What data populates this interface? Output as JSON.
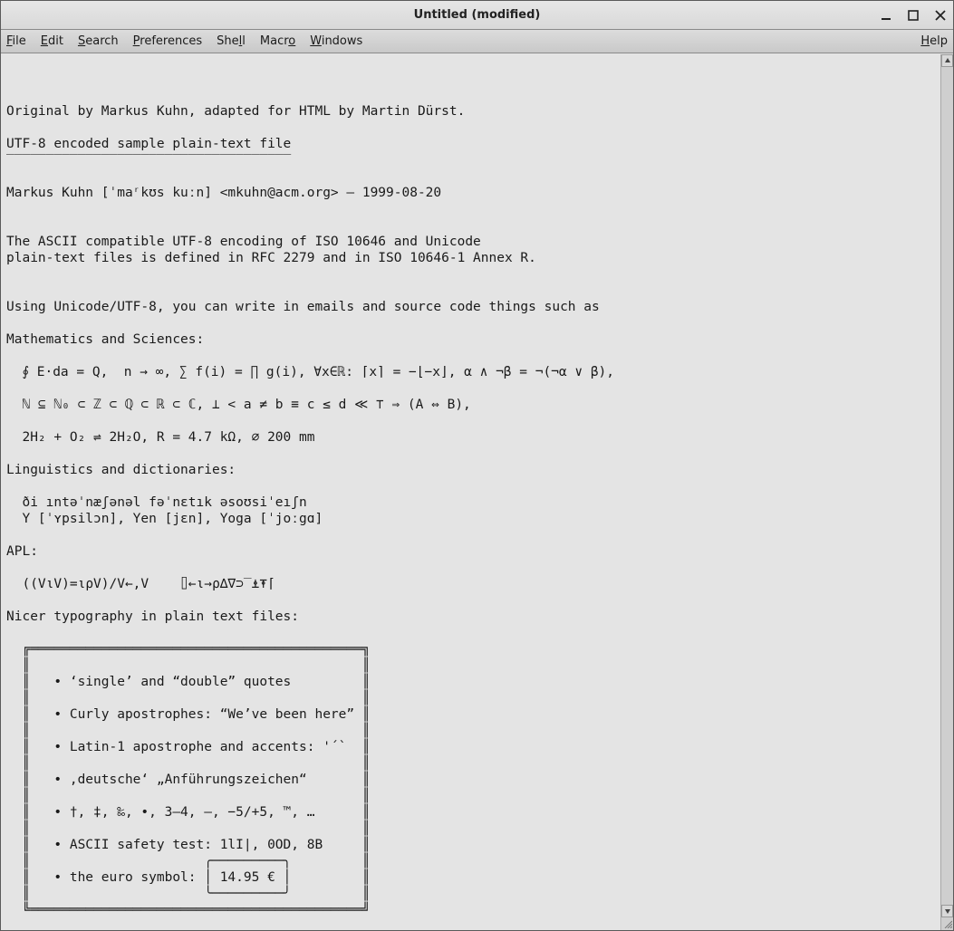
{
  "window": {
    "title": "Untitled (modified)"
  },
  "menu": {
    "file": {
      "label": "File",
      "accel": "F"
    },
    "edit": {
      "label": "Edit",
      "accel": "E"
    },
    "search": {
      "label": "Search",
      "accel": "S"
    },
    "preferences": {
      "label": "Preferences",
      "accel": "P"
    },
    "shell": {
      "label": "Shell",
      "accel": "l"
    },
    "macro": {
      "label": "Macro",
      "accel": "o"
    },
    "windows": {
      "label": "Windows",
      "accel": "W"
    },
    "help": {
      "label": "Help",
      "accel": "H"
    }
  },
  "document": {
    "lines": [
      "",
      "Original by Markus Kuhn, adapted for HTML by Martin Dürst.",
      "",
      "UTF-8 encoded sample plain-text file",
      "‾‾‾‾‾‾‾‾‾‾‾‾‾‾‾‾‾‾‾‾‾‾‾‾‾‾‾‾‾‾‾‾‾‾‾‾",
      "",
      "Markus Kuhn [ˈmaʳkʊs kuːn] <mkuhn@acm.org> — 1999-08-20",
      "",
      "",
      "The ASCII compatible UTF-8 encoding of ISO 10646 and Unicode",
      "plain-text files is defined in RFC 2279 and in ISO 10646-1 Annex R.",
      "",
      "",
      "Using Unicode/UTF-8, you can write in emails and source code things such as",
      "",
      "Mathematics and Sciences:",
      "",
      "  ∮ E⋅da = Q,  n → ∞, ∑ f(i) = ∏ g(i), ∀x∈ℝ: ⌈x⌉ = −⌊−x⌋, α ∧ ¬β = ¬(¬α ∨ β),",
      "",
      "  ℕ ⊆ ℕ₀ ⊂ ℤ ⊂ ℚ ⊂ ℝ ⊂ ℂ, ⊥ < a ≠ b ≡ c ≤ d ≪ ⊤ ⇒ (A ⇔ B),",
      "",
      "  2H₂ + O₂ ⇌ 2H₂O, R = 4.7 kΩ, ⌀ 200 mm",
      "",
      "Linguistics and dictionaries:",
      "",
      "  ði ıntəˈnæʃənəl fəˈnɛtık əsoʊsiˈeıʃn",
      "  Y [ˈʏpsilɔn], Yen [jɛn], Yoga [ˈjoːgɑ]",
      "",
      "APL:",
      "",
      "  ((V⍳V)=⍳⍴V)/V←,V    ⌷←⍳→⍴∆∇⊃‾⍎⍕⌈",
      "",
      "Nicer typography in plain text files:",
      "",
      "  ╔══════════════════════════════════════════╗",
      "  ║                                          ║",
      "  ║   • ‘single’ and “double” quotes         ║",
      "  ║                                          ║",
      "  ║   • Curly apostrophes: “We’ve been here” ║",
      "  ║                                          ║",
      "  ║   • Latin-1 apostrophe and accents: '´`  ║",
      "  ║                                          ║",
      "  ║   • ‚deutsche‘ „Anführungszeichen“       ║",
      "  ║                                          ║",
      "  ║   • †, ‡, ‰, •, 3–4, —, −5/+5, ™, …      ║",
      "  ║                                          ║",
      "  ║   • ASCII safety test: 1lI|, 0OD, 8B     ║",
      "  ║                      ╭─────────╮         ║",
      "  ║   • the euro symbol: │ 14.95 € │         ║",
      "  ║                      ╰─────────╯         ║",
      "  ╚══════════════════════════════════════════╝",
      ""
    ]
  }
}
